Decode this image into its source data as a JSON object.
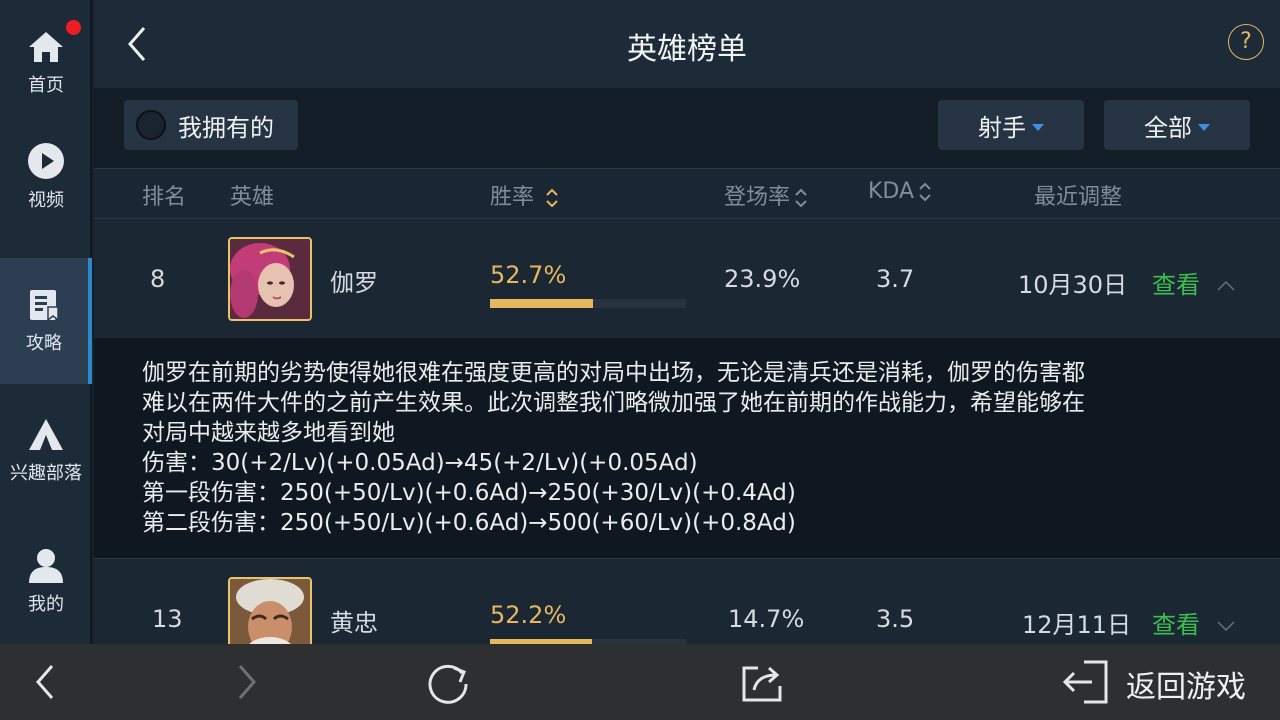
{
  "sidebar": {
    "items": [
      {
        "label": "首页",
        "icon": "home-icon",
        "badge": true
      },
      {
        "label": "视频",
        "icon": "play-icon"
      },
      {
        "label": "攻略",
        "icon": "guide-icon",
        "active": true
      },
      {
        "label": "兴趣部落",
        "icon": "tent-icon"
      },
      {
        "label": "我的",
        "icon": "user-icon"
      }
    ]
  },
  "header": {
    "title": "英雄榜单",
    "help": "?"
  },
  "filters": {
    "owned_label": "我拥有的",
    "role": "射手",
    "scope": "全部"
  },
  "columns": {
    "rank": "排名",
    "hero": "英雄",
    "winrate": "胜率",
    "pickrate": "登场率",
    "kda": "KDA",
    "recent": "最近调整"
  },
  "rows": [
    {
      "rank": "8",
      "name": "伽罗",
      "winrate": "52.7%",
      "winrate_fill": 0.527,
      "pickrate": "23.9%",
      "kda": "3.7",
      "date": "10月30日",
      "view": "查看",
      "expanded": true
    },
    {
      "rank": "13",
      "name": "黄忠",
      "winrate": "52.2%",
      "winrate_fill": 0.522,
      "pickrate": "14.7%",
      "kda": "3.5",
      "date": "12月11日",
      "view": "查看",
      "expanded": false
    }
  ],
  "detail": {
    "lines": [
      "伽罗在前期的劣势使得她很难在强度更高的对局中出场，无论是清兵还是消耗，伽罗的伤害都",
      "难以在两件大件的之前产生效果。此次调整我们略微加强了她在前期的作战能力，希望能够在",
      "对局中越来越多地看到她",
      "伤害：30(+2/Lv)(+0.05Ad)→45(+2/Lv)(+0.05Ad)",
      "第一段伤害：250(+50/Lv)(+0.6Ad)→250(+30/Lv)(+0.4Ad)",
      "第二段伤害：250(+50/Lv)(+0.6Ad)→500(+60/Lv)(+0.8Ad)"
    ]
  },
  "bottombar": {
    "return_label": "返回游戏"
  },
  "colors": {
    "accent_gold": "#e5b860",
    "link_green": "#3cbf4f",
    "active_blue": "#2f86c8"
  }
}
